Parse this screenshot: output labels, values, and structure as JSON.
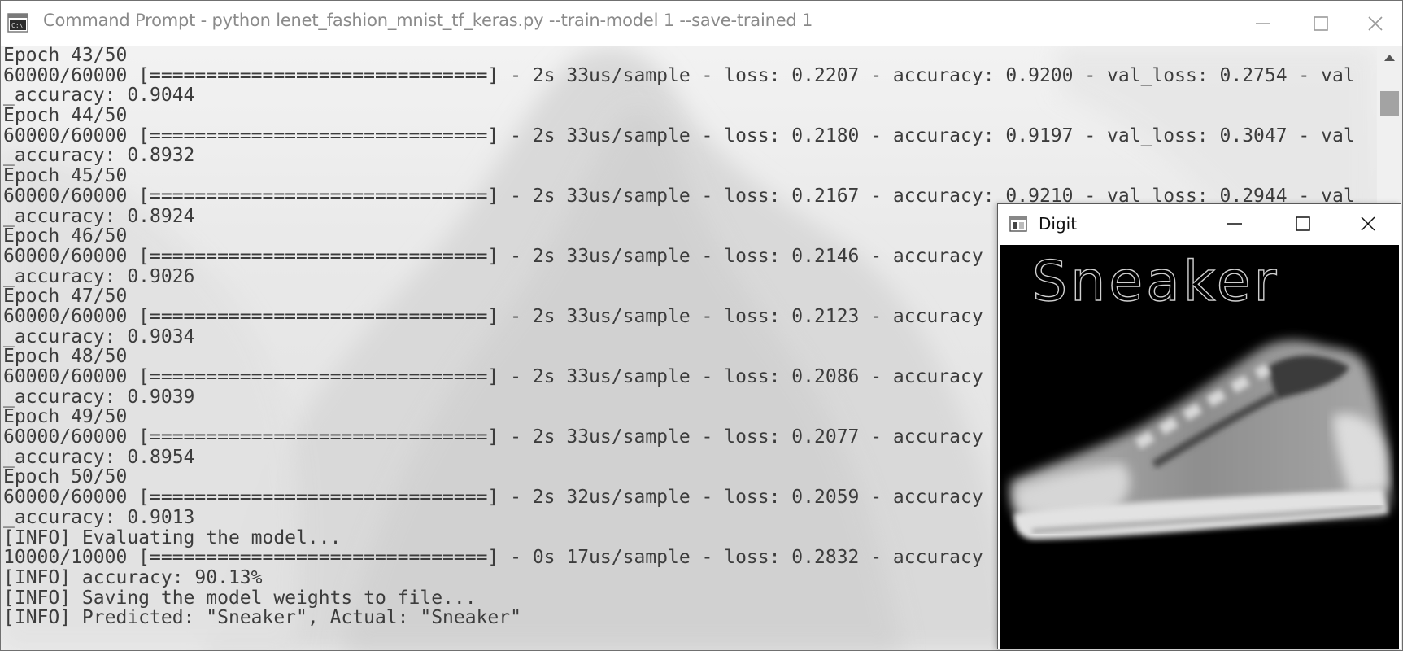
{
  "console_window": {
    "title": "Command Prompt - python  lenet_fashion_mnist_tf_keras.py --train-model 1 --save-trained 1",
    "icon": "cmd-icon",
    "controls": [
      "minimize-icon",
      "maximize-icon",
      "close-icon"
    ]
  },
  "console": {
    "lines": [
      "Epoch 43/50",
      "60000/60000 [==============================] - 2s 33us/sample - loss: 0.2207 - accuracy: 0.9200 - val_loss: 0.2754 - val",
      "_accuracy: 0.9044",
      "Epoch 44/50",
      "60000/60000 [==============================] - 2s 33us/sample - loss: 0.2180 - accuracy: 0.9197 - val_loss: 0.3047 - val",
      "_accuracy: 0.8932",
      "Epoch 45/50",
      "60000/60000 [==============================] - 2s 33us/sample - loss: 0.2167 - accuracy: 0.9210 - val_loss: 0.2944 - val",
      "_accuracy: 0.8924",
      "Epoch 46/50",
      "60000/60000 [==============================] - 2s 33us/sample - loss: 0.2146 - accuracy",
      "_accuracy: 0.9026",
      "Epoch 47/50",
      "60000/60000 [==============================] - 2s 33us/sample - loss: 0.2123 - accuracy",
      "_accuracy: 0.9034",
      "Epoch 48/50",
      "60000/60000 [==============================] - 2s 33us/sample - loss: 0.2086 - accuracy",
      "_accuracy: 0.9039",
      "Epoch 49/50",
      "60000/60000 [==============================] - 2s 33us/sample - loss: 0.2077 - accuracy",
      "_accuracy: 0.8954",
      "Epoch 50/50",
      "60000/60000 [==============================] - 2s 32us/sample - loss: 0.2059 - accuracy",
      "_accuracy: 0.9013",
      "[INFO] Evaluating the model...",
      "10000/10000 [==============================] - 0s 17us/sample - loss: 0.2832 - accuracy",
      "[INFO] accuracy: 90.13%",
      "[INFO] Saving the model weights to file...",
      "[INFO] Predicted: \"Sneaker\", Actual: \"Sneaker\""
    ]
  },
  "digit_window": {
    "title": "Digit",
    "icon": "image-window-icon",
    "controls": [
      "minimize-icon",
      "maximize-icon",
      "close-icon"
    ],
    "prediction_label": "Sneaker",
    "image_subject": "sneaker"
  },
  "colors": {
    "console_text": "#3c3c3c",
    "console_bg": "#ececec",
    "canvas_bg": "#000000",
    "label_outline": "#cfcfcf"
  }
}
